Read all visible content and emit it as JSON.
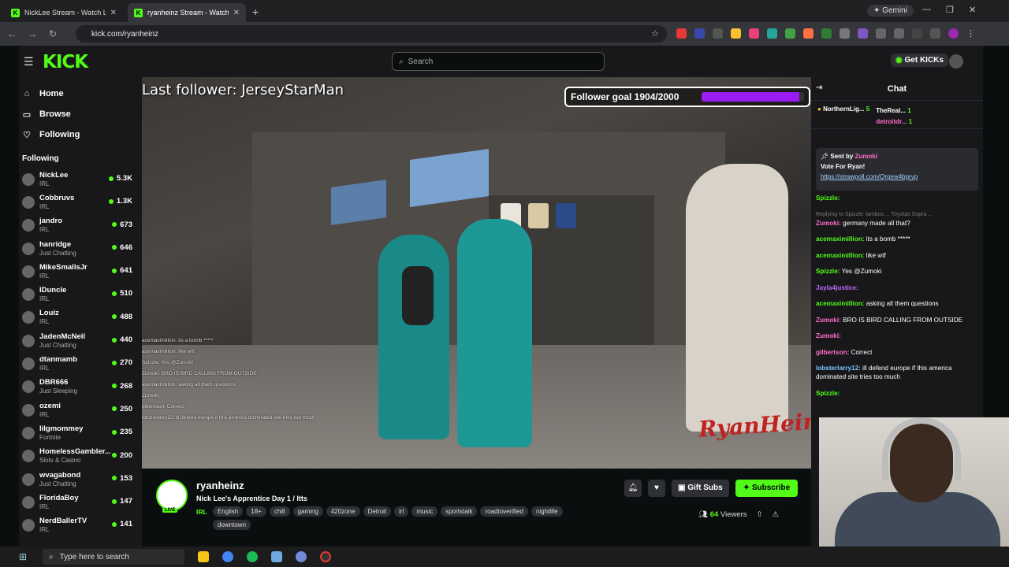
{
  "browser": {
    "tabs": [
      {
        "title": "NickLee Stream - Watch Live on",
        "active": false
      },
      {
        "title": "ryanheinz Stream - Watch L",
        "active": true
      }
    ],
    "new_tab": "+",
    "gemini_label": "Gemini",
    "url": "kick.com/ryanheinz"
  },
  "kick": {
    "logo": "KICK",
    "search_placeholder": "Search",
    "get_kicks_label": "Get KICKs",
    "nav": [
      {
        "label": "Home",
        "icon": "home-icon"
      },
      {
        "label": "Browse",
        "icon": "browse-icon"
      },
      {
        "label": "Following",
        "icon": "heart-icon"
      }
    ],
    "following_header": "Following",
    "following": [
      {
        "name": "NickLee",
        "category": "IRL",
        "viewers": "5.3K"
      },
      {
        "name": "Cobbruvs",
        "category": "IRL",
        "viewers": "1.3K"
      },
      {
        "name": "jandro",
        "category": "IRL",
        "viewers": "673"
      },
      {
        "name": "hanridge",
        "category": "Just Chatting",
        "viewers": "646"
      },
      {
        "name": "MikeSmallsJr",
        "category": "IRL",
        "viewers": "641"
      },
      {
        "name": "IDuncle",
        "category": "IRL",
        "viewers": "510"
      },
      {
        "name": "Louiz",
        "category": "IRL",
        "viewers": "488"
      },
      {
        "name": "JadenMcNeil",
        "category": "Just Chatting",
        "viewers": "440"
      },
      {
        "name": "dtanmamb",
        "category": "IRL",
        "viewers": "270"
      },
      {
        "name": "DBR666",
        "category": "Just Sleeping",
        "viewers": "268"
      },
      {
        "name": "ozemi",
        "category": "IRL",
        "viewers": "250"
      },
      {
        "name": "lilgmommey",
        "category": "Fortnite",
        "viewers": "235"
      },
      {
        "name": "HomelessGambler...",
        "category": "Slots & Casino",
        "viewers": "200"
      },
      {
        "name": "wvagabond",
        "category": "Just Chatting",
        "viewers": "153"
      },
      {
        "name": "FloridaBoy",
        "category": "IRL",
        "viewers": "147"
      },
      {
        "name": "NerdBallerTV",
        "category": "IRL",
        "viewers": "141"
      }
    ]
  },
  "video": {
    "last_follower": "Last follower: JerseyStarMan",
    "follower_goal": "Follower goal 1904/2000",
    "goal_progress": 0.952,
    "watermark": "RyanHeinz",
    "overlay_chat": [
      "acemaximillion: its a bomb *****",
      "acemaximillion: like wtf",
      "Spizzle: Yes @Zumoki",
      "Zumoki: BRO IS BIRD CALLING FROM OUTSIDE",
      "acemaximillion: asking all them questions",
      "Zumoki:",
      "gilbertson: Correct",
      "lobsterlarry12: ill defend europe if this america dominated site tries too much"
    ]
  },
  "stream_info": {
    "channel": "ryanheinz",
    "live": "LIVE",
    "title": "Nick Lee's Apprentice Day 1 / Itts",
    "category": "IRL",
    "tags": [
      "English",
      "18+",
      "chill",
      "gaming",
      "420zone",
      "Detroit",
      "irl",
      "music",
      "sportstalk",
      "roadtoverified",
      "nightlife",
      "downtown"
    ],
    "gift_subs_label": "Gift Subs",
    "subscribe_label": "Subscribe",
    "viewers": "64",
    "viewers_label": "Viewers"
  },
  "chat": {
    "title": "Chat",
    "top_gifters": [
      {
        "name": "NorthernLig...",
        "count": "5"
      },
      {
        "name": "TheReal...",
        "count": "1"
      },
      {
        "name": "detroitdr...",
        "count": "1"
      }
    ],
    "pinned": {
      "sent_by_label": "Sent by",
      "sender": "Zumoki",
      "message": "Vote For Ryan!",
      "link": "https://strawpoll.com/Qrgew4bprvp",
      "mention": "@Zumoki"
    },
    "messages": [
      {
        "user": "Spizzle:",
        "text": "",
        "color": "#53fc18"
      },
      {
        "reply": "Replying to Spizzle: lambos ... Toyotas Supra ...",
        "user": "Zumoki:",
        "text": "germany made all that?",
        "color": "#ff6ec7"
      },
      {
        "user": "acemaximillion:",
        "text": "its a bomb *****",
        "color": "#53fc18"
      },
      {
        "user": "acemaximillion:",
        "text": "like wtf",
        "color": "#53fc18"
      },
      {
        "user": "Spizzle:",
        "text": "Yes @Zumoki",
        "color": "#53fc18"
      },
      {
        "user": "Jayla4justice:",
        "text": "",
        "color": "#b86bff"
      },
      {
        "user": "acemaximillion:",
        "text": "asking all them questions",
        "color": "#53fc18"
      },
      {
        "user": "Zumoki:",
        "text": "BRO IS BIRD CALLING FROM OUTSIDE",
        "color": "#ff6ec7"
      },
      {
        "user": "Zumoki:",
        "text": "",
        "color": "#ff6ec7"
      },
      {
        "user": "gilbertson:",
        "text": "Correct",
        "color": "#ff6ec7"
      },
      {
        "user": "lobsterlarry12:",
        "text": "ill defend europe if this america dominated site tries too much",
        "color": "#7cc7ff"
      },
      {
        "user": "Spizzle:",
        "text": "",
        "color": "#53fc18"
      }
    ]
  },
  "taskbar": {
    "search_placeholder": "Type here to search"
  },
  "colors": {
    "kick_green": "#53fc18",
    "goal_purple": "#9b1cf0"
  }
}
